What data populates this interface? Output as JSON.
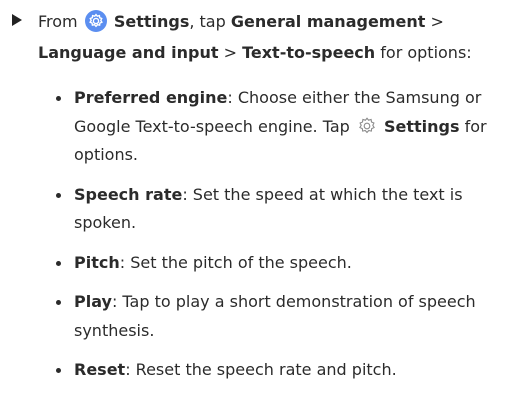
{
  "step": {
    "from": "From",
    "settings": "Settings",
    "tap": ", tap",
    "general_management": "General management",
    "sep1": ">",
    "language_and_input": "Language and input",
    "sep2": ">",
    "text_to_speech": "Text-to-speech",
    "tail": "for options:"
  },
  "options": [
    {
      "label": "Preferred engine",
      "desc_a": ": Choose either the Samsung or Google Text-to-speech engine. Tap",
      "settings": "Settings",
      "desc_b": "for options."
    },
    {
      "label": "Speech rate",
      "desc": ": Set the speed at which the text is spoken."
    },
    {
      "label": "Pitch",
      "desc": ": Set the pitch of the speech."
    },
    {
      "label": "Play",
      "desc": ": Tap to play a short demonstration of speech synthesis."
    },
    {
      "label": "Reset",
      "desc": ": Reset the speech rate and pitch."
    }
  ],
  "icons": {
    "step_marker": "triangle-right-icon",
    "settings_app": "settings-gear-icon",
    "settings_inline": "gear-outline-icon"
  },
  "colors": {
    "settings_icon_bg": "#5b8ef0"
  }
}
